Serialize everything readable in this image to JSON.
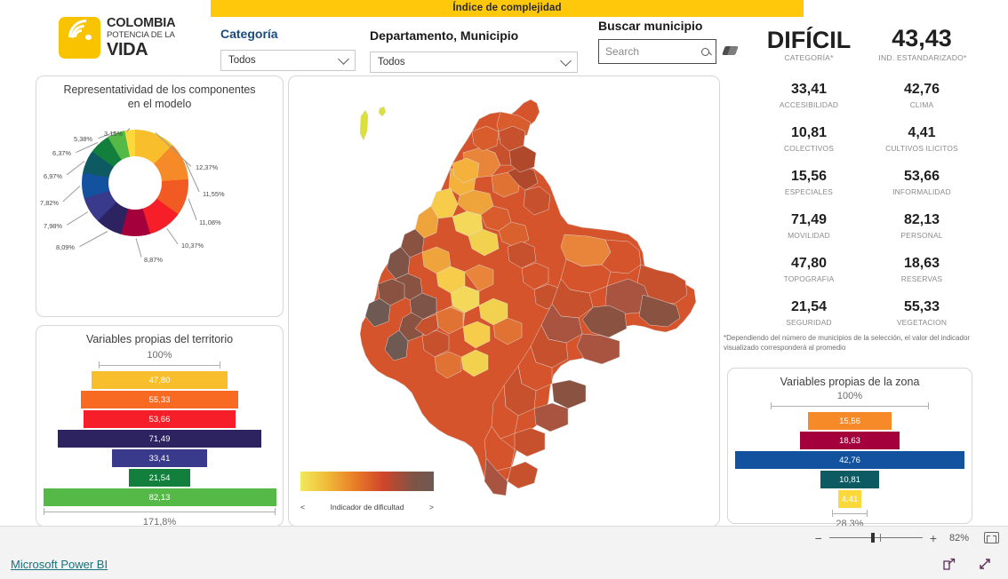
{
  "banner": {
    "title": "Índice de complejidad"
  },
  "logo": {
    "line1": "COLOMBIA",
    "line2": "POTENCIA DE LA",
    "line3": "VIDA"
  },
  "filters": {
    "categoria_label": "Categoría",
    "categoria_value": "Todos",
    "depmun_label": "Departamento, Municipio",
    "depmun_value": "Todos",
    "buscar_label": "Buscar municipio",
    "search_placeholder": "Search"
  },
  "donut_card": {
    "title": "Representatividad de los componentes en el modelo"
  },
  "territorio_card": {
    "title": "Variables propias del territorio",
    "top_pct": "100%",
    "bottom_pct": "171,8%"
  },
  "zona_card": {
    "title": "Variables propias de la zona",
    "top_pct": "100%",
    "bottom_pct": "28,3%"
  },
  "map": {
    "legend_title": "Indicador de dificultad",
    "legend_left": "<",
    "legend_right": ">"
  },
  "kpi": {
    "categoria_value": "DIFÍCIL",
    "categoria_label": "CATEGORÍA*",
    "indice_value": "43,43",
    "indice_label": "IND. ESTANDARIZADO*",
    "items": [
      {
        "value": "33,41",
        "label": "ACCESIBILIDAD"
      },
      {
        "value": "42,76",
        "label": "CLIMA"
      },
      {
        "value": "10,81",
        "label": "COLECTIVOS"
      },
      {
        "value": "4,41",
        "label": "CULTIVOS ILICITOS"
      },
      {
        "value": "15,56",
        "label": "ESPECIALES"
      },
      {
        "value": "53,66",
        "label": "INFORMALIDAD"
      },
      {
        "value": "71,49",
        "label": "MOVILIDAD"
      },
      {
        "value": "82,13",
        "label": "PERSONAL"
      },
      {
        "value": "47,80",
        "label": "TOPOGRAFIA"
      },
      {
        "value": "18,63",
        "label": "RESERVAS"
      },
      {
        "value": "21,54",
        "label": "SEGURIDAD"
      },
      {
        "value": "55,33",
        "label": "VEGETACION"
      }
    ],
    "footnote": "*Dependiendo del número de municipios de la selección, el valor del indicador visualizado corresponderá al promedio"
  },
  "toolbar": {
    "minus": "−",
    "plus": "+",
    "zoom_level": "82%"
  },
  "footer": {
    "powerbi_label": "Microsoft Power BI"
  },
  "chart_data": [
    {
      "type": "pie",
      "title": "Representatividad de los componentes en el modelo",
      "labels": [
        "12,37%",
        "11,55%",
        "11,08%",
        "10,37%",
        "8,87%",
        "8,09%",
        "7,98%",
        "7,82%",
        "6,97%",
        "6,37%",
        "5,38%",
        "3,15%"
      ],
      "values": [
        12.37,
        11.55,
        11.08,
        10.37,
        8.87,
        8.09,
        7.98,
        7.82,
        6.97,
        6.37,
        5.38,
        3.15
      ],
      "colors": [
        "#F9BE2C",
        "#F68A28",
        "#F15A22",
        "#F61E28",
        "#A3003C",
        "#2C2360",
        "#3A3A8C",
        "#12529E",
        "#0E5A63",
        "#12803C",
        "#55B948",
        "#FCD93B"
      ],
      "legend": "none",
      "grid": false
    },
    {
      "type": "bar",
      "title": "Variables propias del territorio",
      "orientation": "funnel",
      "axis_top": "100%",
      "axis_bottom": "171,8%",
      "categories": [
        "TOPOGRAFIA",
        "VEGETACION",
        "INFORMALIDAD",
        "MOVILIDAD",
        "ACCESIBILIDAD",
        "SEGURIDAD",
        "PERSONAL"
      ],
      "values": [
        47.8,
        55.33,
        53.66,
        71.49,
        33.41,
        21.54,
        82.13
      ],
      "labels": [
        "47,80",
        "55,33",
        "53,66",
        "71,49",
        "33,41",
        "21,54",
        "82,13"
      ],
      "colors": [
        "#F9BE2C",
        "#F86A22",
        "#F61E28",
        "#2C2360",
        "#3A3A8C",
        "#12803C",
        "#55B948"
      ],
      "grid": false
    },
    {
      "type": "bar",
      "title": "Variables propias de la zona",
      "orientation": "funnel",
      "axis_top": "100%",
      "axis_bottom": "28,3%",
      "categories": [
        "ESPECIALES",
        "RESERVAS",
        "CLIMA",
        "COLECTIVOS",
        "CULTIVOS ILICITOS"
      ],
      "values": [
        15.56,
        18.63,
        42.76,
        10.81,
        4.41
      ],
      "labels": [
        "15,56",
        "18,63",
        "42,76",
        "10,81",
        "4,41"
      ],
      "colors": [
        "#F68A28",
        "#A3003C",
        "#12529E",
        "#0E5A63",
        "#FCD93B"
      ],
      "grid": false
    }
  ]
}
